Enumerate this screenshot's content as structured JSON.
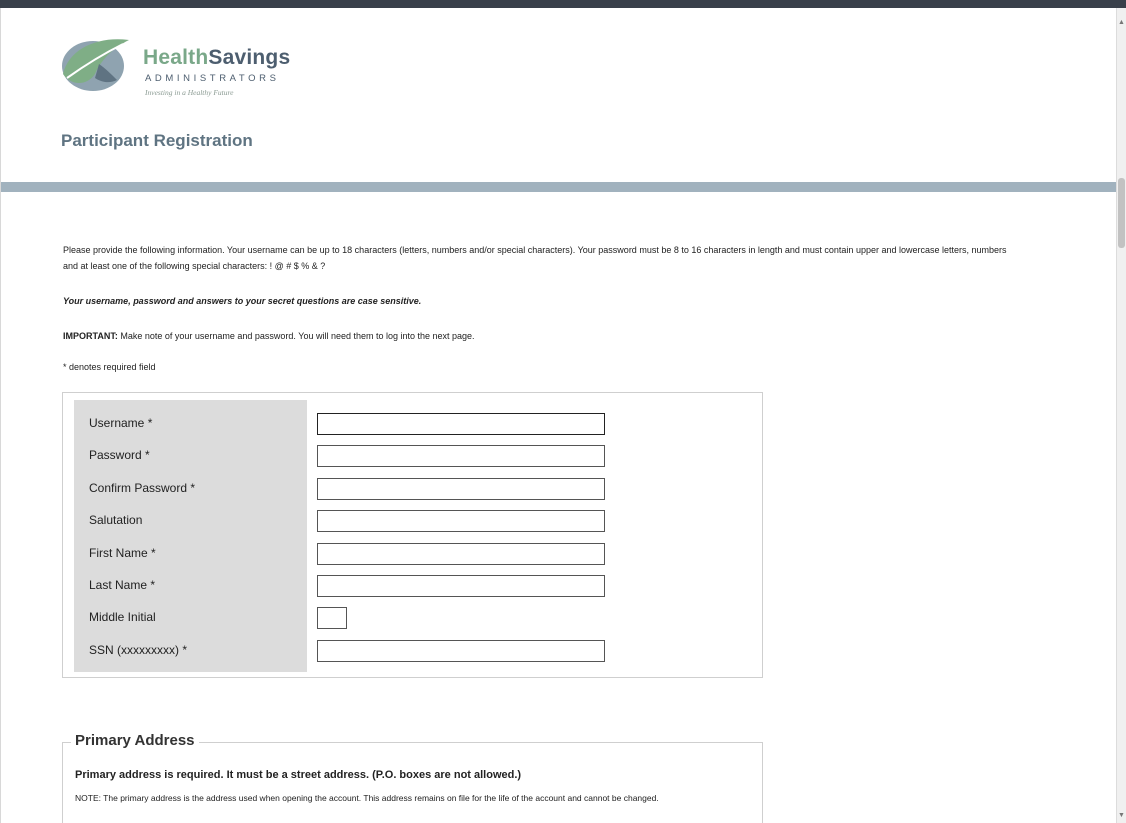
{
  "brand": {
    "word_1": "Health",
    "word_2": "Savings",
    "subtitle": "ADMINISTRATORS",
    "tagline": "Investing in a Healthy Future",
    "colors": {
      "green": "#7aa889",
      "slate": "#4d5e6f",
      "header_bar": "#a1b2be"
    }
  },
  "page": {
    "title": "Participant Registration"
  },
  "instructions": {
    "intro": "Please provide the following information. Your username can be up to 18 characters (letters, numbers and/or special characters). Your password must be 8 to 16 characters in length and must contain upper and lowercase letters, numbers and at least one of the following special characters: ! @ # $ % & ?",
    "case_sensitive": "Your username, password and answers to your secret questions are case sensitive.",
    "important_label": "IMPORTANT:",
    "important_text": " Make note of your username and password. You will need them to log into the next page.",
    "required_note": "* denotes required field"
  },
  "form": {
    "fields": [
      {
        "label": "Username *",
        "value": ""
      },
      {
        "label": "Password *",
        "value": ""
      },
      {
        "label": "Confirm Password *",
        "value": ""
      },
      {
        "label": "Salutation",
        "value": ""
      },
      {
        "label": "First Name *",
        "value": ""
      },
      {
        "label": "Last Name *",
        "value": ""
      },
      {
        "label": "Middle Initial",
        "value": ""
      },
      {
        "label": "SSN (xxxxxxxxx) *",
        "value": ""
      }
    ]
  },
  "primary_address": {
    "legend": "Primary Address",
    "required_text": "Primary address is required. It must be a street address. (P.O. boxes are not allowed.)",
    "note": "NOTE: The primary address is the address used when opening the account. This address remains on file for the life of the account and cannot be changed."
  },
  "scrollbar": {
    "up_icon": "triangle-up-icon",
    "down_icon": "triangle-down-icon"
  }
}
